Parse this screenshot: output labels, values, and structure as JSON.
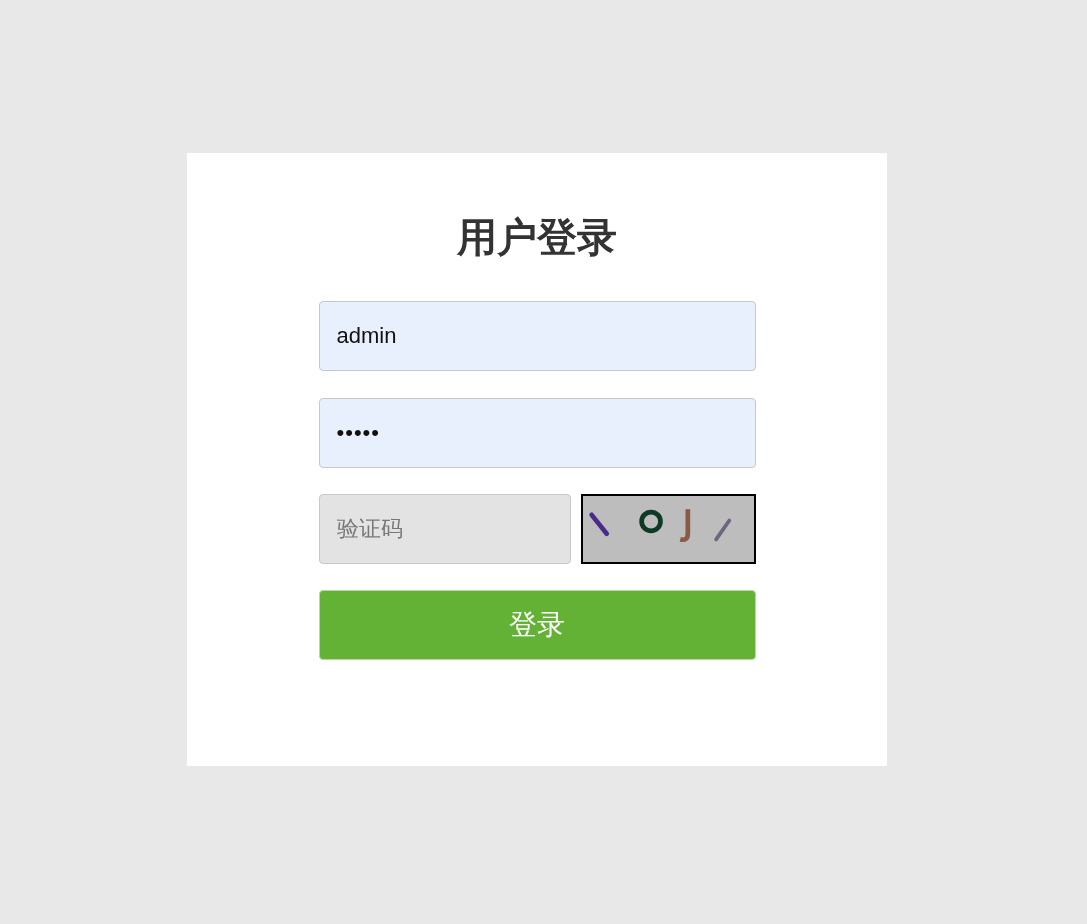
{
  "title": "用户登录",
  "fields": [
    {
      "kind": "username",
      "value": "admin"
    },
    {
      "kind": "password",
      "value": "•••••"
    }
  ],
  "captcha": {
    "placeholder": "验证码",
    "kind": "picture"
  },
  "button": "登录"
}
